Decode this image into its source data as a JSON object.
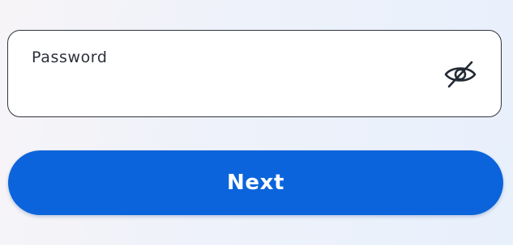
{
  "password_field": {
    "label": "Password",
    "value": "",
    "placeholder": "",
    "visibility_toggle_icon": "eye-slash-icon"
  },
  "next_button": {
    "label": "Next",
    "color": "#0b64db"
  }
}
